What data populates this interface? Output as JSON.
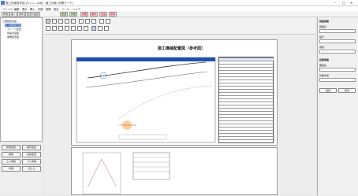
{
  "window": {
    "title": "施工計画書作成 [C:\\...\\...cad] - 施工計画 (作業モード)"
  },
  "menu": [
    "ファイル",
    "編集",
    "表示",
    "挿入",
    "作図",
    "配置",
    "設定",
    "ツール",
    "ヘルプ"
  ],
  "topbar": {
    "buttons": [
      "新規",
      "開く",
      "保存",
      "配置計画図"
    ],
    "green_buttons": [
      "配置",
      "作図"
    ],
    "pink_buttons": [
      "重機",
      "機材",
      "仮設",
      "車両"
    ]
  },
  "tree": [
    "工事配置計画",
    "施工機械配置図",
    "クレーン配置",
    "仮設計画図",
    "重機配置図"
  ],
  "left_buttons": [
    "新規追加",
    "複写追加",
    "削除",
    "名前変更",
    "上に移動",
    "下に移動",
    "印刷",
    "閉じる"
  ],
  "sheet": {
    "title": "施工機械配置図（参考図）"
  },
  "right_panel": {
    "labels": [
      "図面情報",
      "図面名",
      "縮尺",
      "用紙",
      "配置情報",
      "機械名",
      "作業半径"
    ],
    "buttons": [
      "適用",
      "取消"
    ]
  },
  "colors": {
    "accent": "#2b63c6",
    "tool_green": "#cfe9b8",
    "tool_pink": "#f6d2d6"
  }
}
